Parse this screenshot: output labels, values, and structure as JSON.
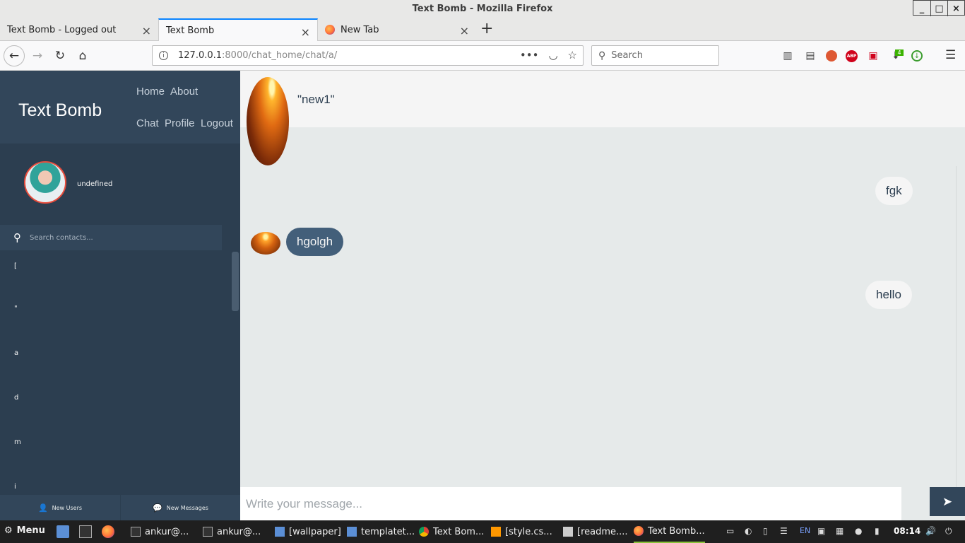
{
  "window": {
    "title": "Text Bomb - Mozilla Firefox",
    "controls": [
      "_",
      "□",
      "×"
    ]
  },
  "tabs": [
    {
      "label": "Text Bomb - Logged out"
    },
    {
      "label": "Text Bomb"
    },
    {
      "label": "New Tab"
    }
  ],
  "navbar": {
    "url_host": "127.0.0.1",
    "url_port": ":8000",
    "url_path": "/chat_home/chat/a/",
    "search_placeholder": "Search",
    "addon_badge": "4"
  },
  "app": {
    "brand": "Text Bomb",
    "menu": {
      "home": "Home",
      "about": "About",
      "chat": "Chat",
      "profile": "Profile",
      "logout": "Logout"
    },
    "profile_name": "undefined",
    "search_placeholder": "Search contacts...",
    "contacts": [
      "[",
      "\"",
      "a",
      "d",
      "m",
      "i"
    ],
    "bottom": {
      "new_users": "New Users",
      "new_messages": "New Messages"
    }
  },
  "chat": {
    "contact_name": "\"new1\"",
    "messages": [
      {
        "text": "fgk",
        "direction": "sent"
      },
      {
        "text": "hgolgh",
        "direction": "received"
      },
      {
        "text": "hello",
        "direction": "sent"
      }
    ],
    "composer_placeholder": "Write your message..."
  },
  "taskbar": {
    "menu_label": "Menu",
    "tasks": [
      "ankur@...",
      "ankur@...",
      "[wallpaper]",
      "templatet...",
      "Text Bom...",
      "[style.cs...",
      "[readme....",
      "Text Bomb..."
    ],
    "keyboard_layout": "EN",
    "clock": "08:14"
  },
  "colors": {
    "sidebar": "#2c3e50",
    "sidebar_light": "#32465a",
    "received_bubble": "#435f7a",
    "chat_bg": "#e6eaea",
    "avatar_border": "#e74c3c"
  }
}
